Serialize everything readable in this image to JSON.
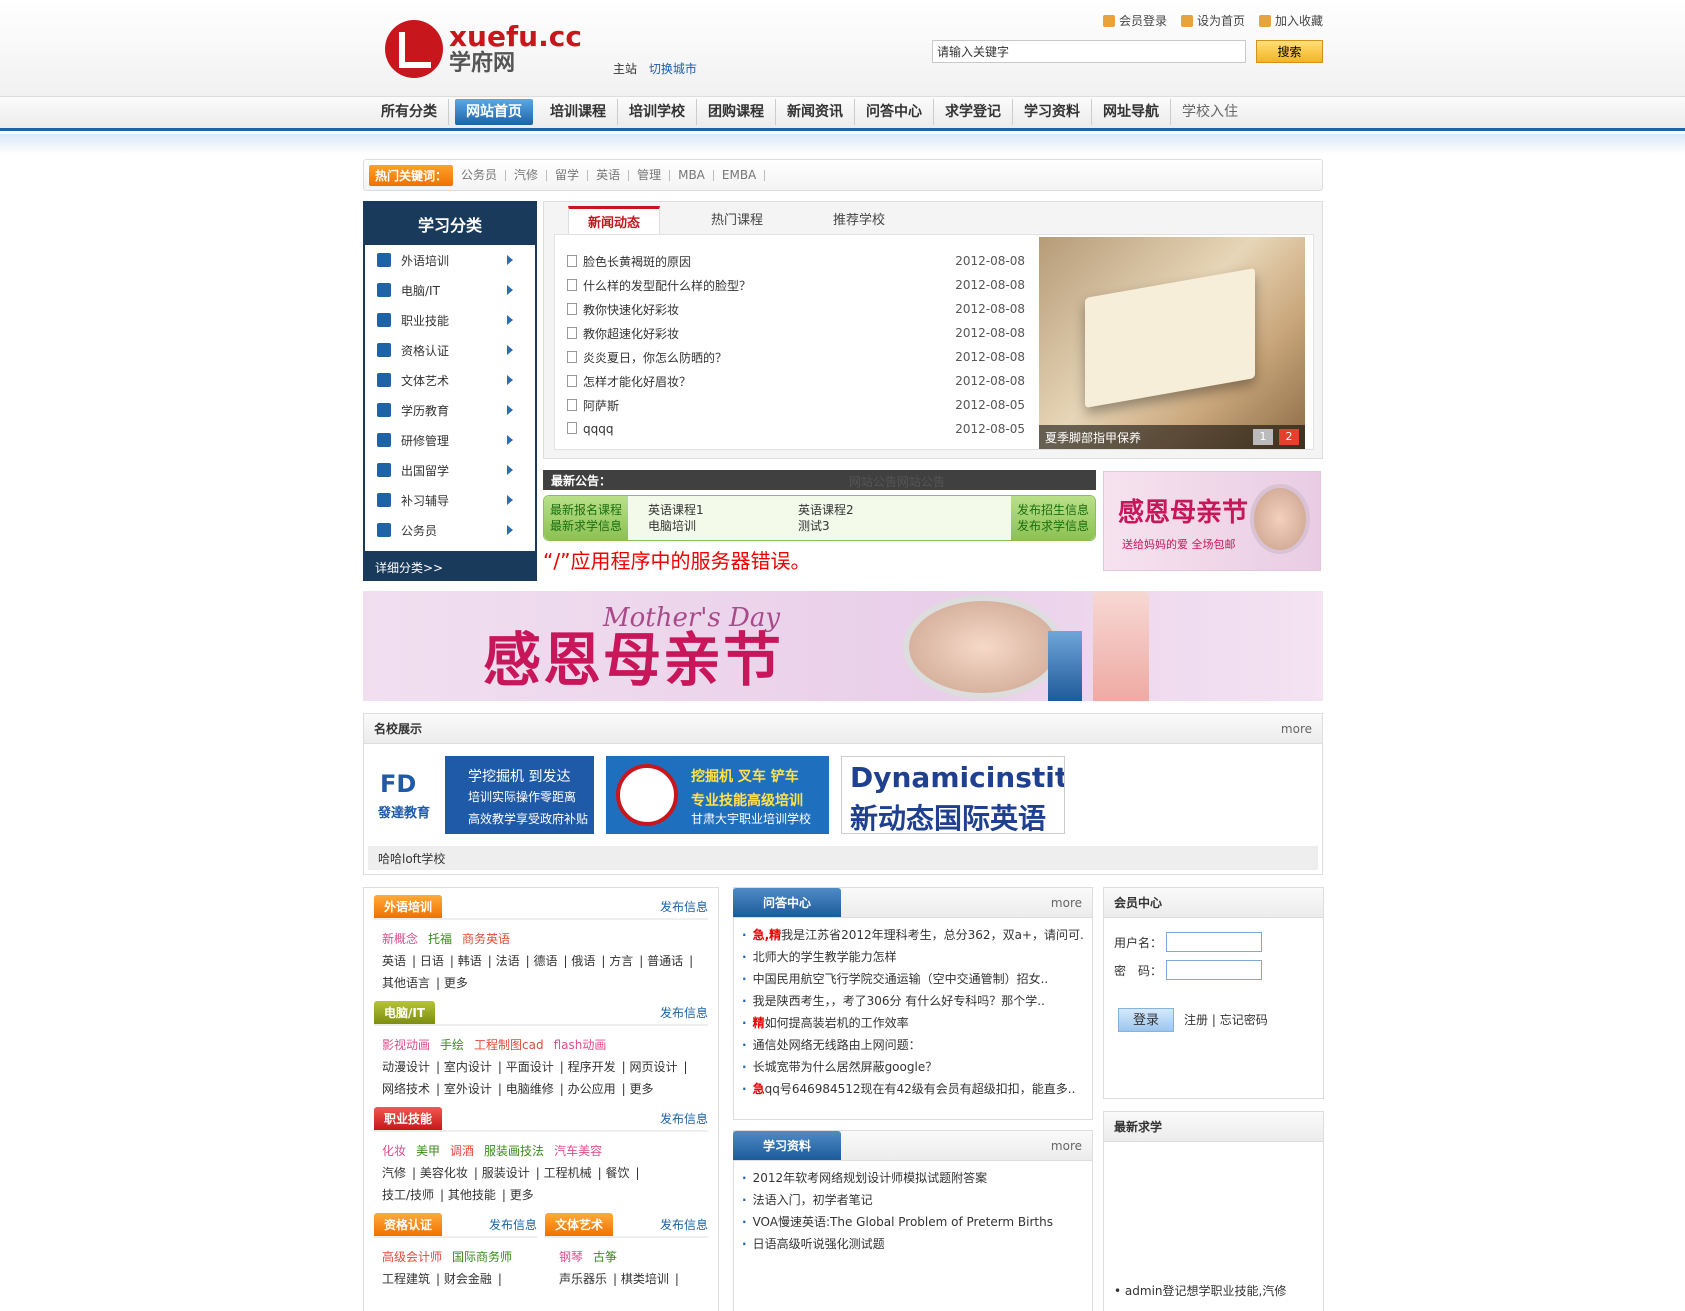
{
  "logo": {
    "en": "xuefu.cc",
    "cn": "学府网"
  },
  "site": {
    "main": "主站",
    "switch": "切换城市"
  },
  "toplinks": [
    "会员登录",
    "设为首页",
    "加入收藏"
  ],
  "search": {
    "value": "请输入关键字",
    "button": "搜索"
  },
  "nav": [
    "所有分类",
    "网站首页",
    "培训课程",
    "培训学校",
    "团购课程",
    "新闻资讯",
    "问答中心",
    "求学登记",
    "学习资料",
    "网址导航",
    "学校入住"
  ],
  "hot": {
    "label": "热门关键词：",
    "items": [
      "公务员",
      "汽修",
      "留学",
      "英语",
      "管理",
      "MBA",
      "EMBA"
    ]
  },
  "cat": {
    "title": "学习分类",
    "items": [
      "外语培训",
      "电脑/IT",
      "职业技能",
      "资格认证",
      "文体艺术",
      "学历教育",
      "研修管理",
      "出国留学",
      "补习辅导",
      "公务员"
    ],
    "more": "详细分类>>"
  },
  "tabs": [
    "新闻动态",
    "热门课程",
    "推荐学校"
  ],
  "news": [
    {
      "t": "脸色长黄褐斑的原因",
      "d": "2012-08-08"
    },
    {
      "t": "什么样的发型配什么样的脸型？",
      "d": "2012-08-08"
    },
    {
      "t": "教你快速化好彩妆",
      "d": "2012-08-08"
    },
    {
      "t": "教你超速化好彩妆",
      "d": "2012-08-08"
    },
    {
      "t": "炎炎夏日，你怎么防晒的？",
      "d": "2012-08-08"
    },
    {
      "t": "怎样才能化好眉妆？",
      "d": "2012-08-08"
    },
    {
      "t": "阿萨斯",
      "d": "2012-08-05"
    },
    {
      "t": "qqqq",
      "d": "2012-08-05"
    }
  ],
  "photo": {
    "caption": "夏季脚部指甲保养",
    "p1": "1",
    "p2": "2"
  },
  "notice": {
    "label": "最新公告：",
    "msg": "网站公告网站公告"
  },
  "stripe": {
    "l1": "最新报名课程",
    "l2": "最新求学信息",
    "c1a": "英语课程1",
    "c1b": "电脑培训",
    "c2a": "英语课程2",
    "c2b": "测试3",
    "r1": "发布招生信息",
    "r2": "发布求学信息"
  },
  "error": "“/”应用程序中的服务器错误。",
  "ad_small": {
    "t1": "感恩母亲节",
    "t2": "送给妈妈的爱 全场包邮",
    "script": "Mother's Day"
  },
  "banner": {
    "t": "感恩母亲节",
    "sub": "Mother's Day"
  },
  "schools": {
    "title": "名校展示",
    "more": "more",
    "s1": {
      "logo": "FD",
      "logo2": "發達教育",
      "a": "学挖掘机 到发达",
      "b": "培训实际操作零距离",
      "c": "高效教学享受政府补贴"
    },
    "s2": {
      "a": "挖掘机 叉车 铲车",
      "b": "专业技能高级培训",
      "c": "甘肃大宇职业培训学校"
    },
    "s3": {
      "a": "Dynamicinstitute",
      "b": "新动态国际英语"
    },
    "name": "哈哈loft学校"
  },
  "sec1": {
    "title": "外语培训",
    "post": "发布信息",
    "hl": [
      "新概念",
      "托福",
      "商务英语"
    ],
    "items": [
      "英语",
      "日语",
      "韩语",
      "法语",
      "德语",
      "俄语",
      "方言",
      "普通话",
      "其他语言",
      "更多"
    ]
  },
  "sec2": {
    "title": "电脑/IT",
    "post": "发布信息",
    "hl": [
      "影视动画",
      "手绘",
      "工程制图cad",
      "flash动画"
    ],
    "items": [
      "动漫设计",
      "室内设计",
      "平面设计",
      "程序开发",
      "网页设计",
      "网络技术",
      "室外设计",
      "电脑维修",
      "办公应用",
      "更多"
    ]
  },
  "sec3": {
    "title": "职业技能",
    "post": "发布信息",
    "hl": [
      "化妆",
      "美甲",
      "调酒",
      "服装画技法",
      "汽车美容"
    ],
    "items": [
      "汽修",
      "美容化妆",
      "服装设计",
      "工程机械",
      "餐饮",
      "技工/技师",
      "其他技能",
      "更多"
    ]
  },
  "sec4": {
    "title": "资格认证",
    "post": "发布信息",
    "hl": [
      "高级会计师",
      "国际商务师"
    ],
    "items": [
      "工程建筑",
      "财会金融"
    ]
  },
  "sec5": {
    "title": "文体艺术",
    "post": "发布信息",
    "hl": [
      "钢琴",
      "古筝"
    ],
    "items": [
      "声乐器乐",
      "棋类培训"
    ]
  },
  "qa": {
    "title": "问答中心",
    "more": "more",
    "items": [
      {
        "tag": "急,精",
        "t": "我是江苏省2012年理科考生，总分362，双a+，请问可.."
      },
      {
        "tag": "",
        "t": "北师大的学生教学能力怎样"
      },
      {
        "tag": "",
        "t": "中国民用航空飞行学院交通运输（空中交通管制）招女.."
      },
      {
        "tag": "",
        "t": "我是陕西考生，，考了306分 有什么好专科吗？那个学.."
      },
      {
        "tag": "精",
        "t": "如何提高装岩机的工作效率"
      },
      {
        "tag": "",
        "t": "通信处网络无线路由上网问题："
      },
      {
        "tag": "",
        "t": "长城宽带为什么居然屏蔽google？"
      },
      {
        "tag": "急",
        "t": "qq号646984512现在有42级有会员有超级扣扣，能直多.."
      }
    ]
  },
  "ziliao": {
    "title": "学习资料",
    "more": "more",
    "items": [
      "2012年软考网络规划设计师模拟试题附答案",
      "法语入门，初学者笔记",
      "VOA慢速英语:The Global Problem of Preterm Births",
      "日语高级听说强化测试题"
    ]
  },
  "member": {
    "title": "会员中心",
    "user": "用户名：",
    "pass": "密　码：",
    "login": "登录",
    "reg": "注册",
    "forget": "忘记密码"
  },
  "qiuxue": {
    "title": "最新求学",
    "item": "admin登记想学职业技能,汽修"
  }
}
